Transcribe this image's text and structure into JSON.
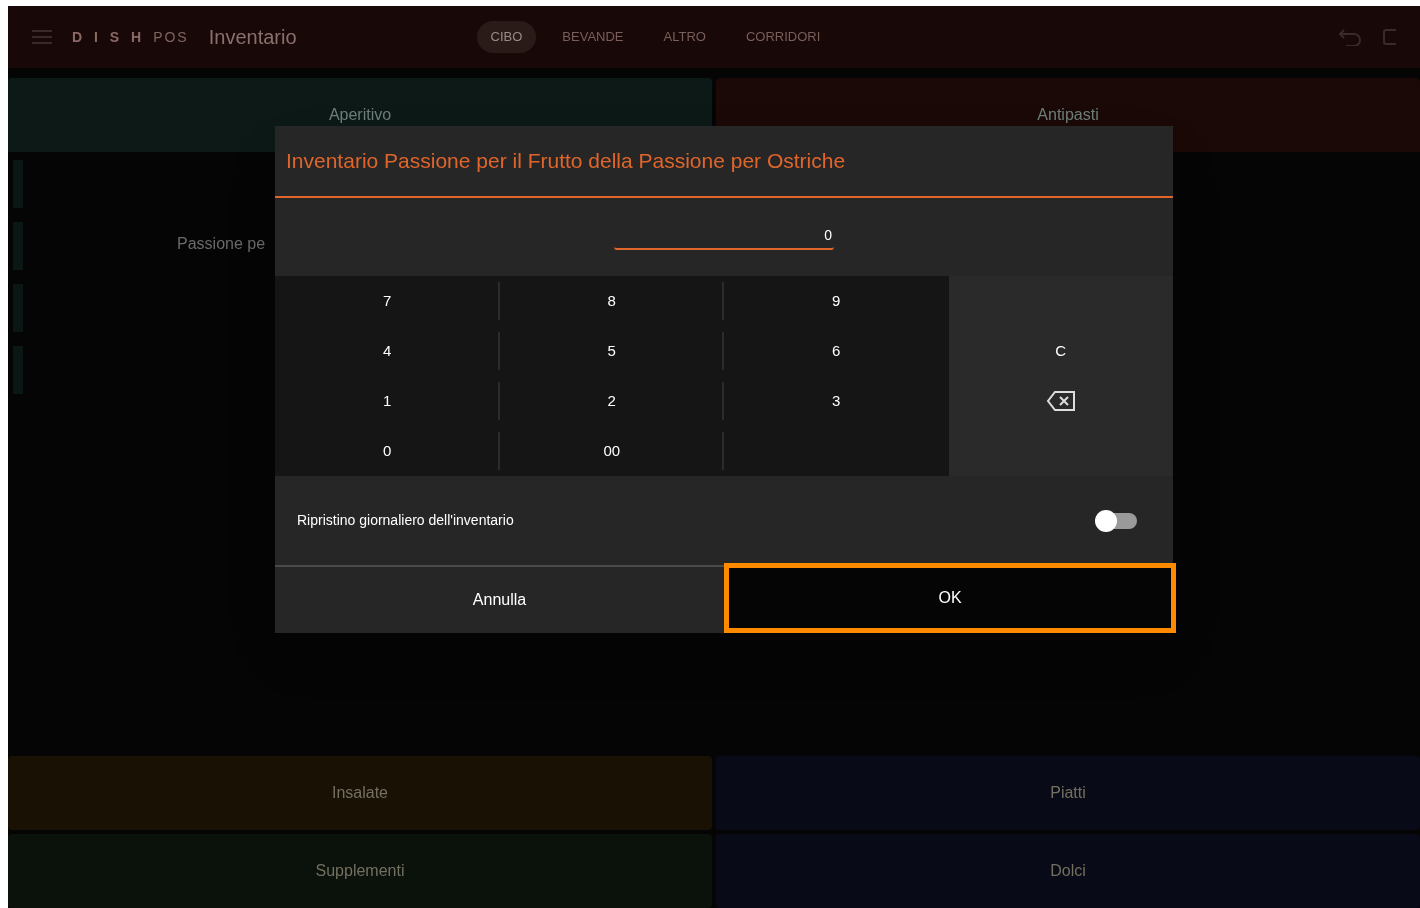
{
  "header": {
    "logo_main": "D I S H",
    "logo_sub": "POS",
    "title": "Inventario",
    "tabs": [
      {
        "label": "CIBO",
        "selected": true
      },
      {
        "label": "BEVANDE",
        "selected": false
      },
      {
        "label": "ALTRO",
        "selected": false
      },
      {
        "label": "CORRIDORI",
        "selected": false
      }
    ]
  },
  "top_categories": [
    {
      "label": "Aperitivo",
      "color": "#0c1917"
    },
    {
      "label": "Antipasti",
      "color": "#1a0907"
    }
  ],
  "items": [
    {
      "label": "Passione pe"
    }
  ],
  "bottom_categories": [
    {
      "label": "Insalate",
      "color": "#191204"
    },
    {
      "label": "Piatti",
      "color": "#090a18"
    },
    {
      "label": "Supplementi",
      "color": "#0b120b"
    },
    {
      "label": "Dolci",
      "color": "#090a18"
    }
  ],
  "dialog": {
    "title": "Inventario Passione per il Frutto della Passione per Ostriche",
    "value": "0",
    "keypad": [
      {
        "kind": "digit",
        "label": "7"
      },
      {
        "kind": "digit",
        "label": "8"
      },
      {
        "kind": "digit",
        "label": "9"
      },
      {
        "kind": "blank"
      },
      {
        "kind": "digit",
        "label": "4"
      },
      {
        "kind": "digit",
        "label": "5"
      },
      {
        "kind": "digit",
        "label": "6"
      },
      {
        "kind": "clear",
        "label": "C"
      },
      {
        "kind": "digit",
        "label": "1"
      },
      {
        "kind": "digit",
        "label": "2"
      },
      {
        "kind": "digit",
        "label": "3"
      },
      {
        "kind": "backspace"
      },
      {
        "kind": "digit",
        "label": "0"
      },
      {
        "kind": "digit",
        "label": "00"
      },
      {
        "kind": "blank_dark"
      },
      {
        "kind": "blank"
      }
    ],
    "toggle": {
      "label": "Ripristino giornaliero dell'inventario",
      "on": false
    },
    "buttons": [
      {
        "label": "Annulla",
        "highlighted": false
      },
      {
        "label": "OK",
        "highlighted": true
      }
    ]
  }
}
